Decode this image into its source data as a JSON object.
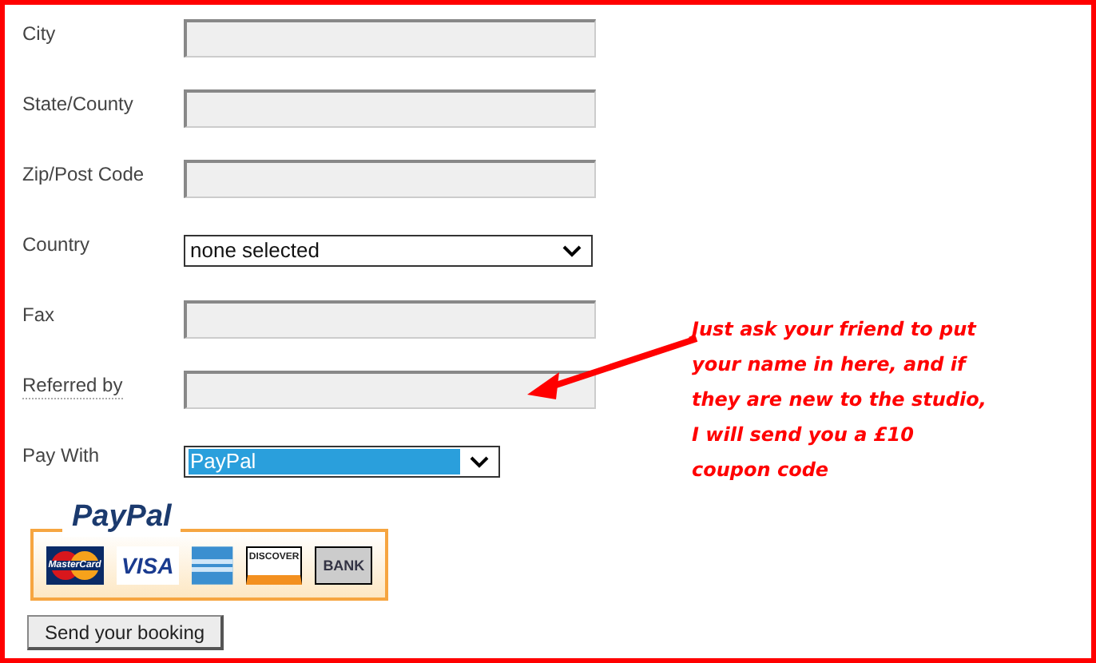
{
  "fields": [
    {
      "label": "City",
      "kind": "text",
      "dotted": false,
      "focused": false
    },
    {
      "label": "State/County",
      "kind": "text",
      "dotted": false,
      "focused": false
    },
    {
      "label": "Zip/Post Code",
      "kind": "text",
      "dotted": false,
      "focused": false
    },
    {
      "label": "Country",
      "kind": "select",
      "value": "none selected",
      "dotted": false,
      "focused": false
    },
    {
      "label": "Fax",
      "kind": "text",
      "dotted": false,
      "focused": false
    },
    {
      "label": "Referred by",
      "kind": "text",
      "dotted": true,
      "focused": false
    },
    {
      "label": "Pay With",
      "kind": "select",
      "value": "PayPal",
      "dotted": false,
      "focused": true
    }
  ],
  "payment_logos": {
    "brand": "PayPal",
    "cards": [
      {
        "kind": "mastercard",
        "label": "MasterCard"
      },
      {
        "kind": "visa",
        "label": "VISA"
      },
      {
        "kind": "amex"
      },
      {
        "kind": "discover",
        "label": "DISCOVER"
      },
      {
        "kind": "bank",
        "label": "BANK"
      }
    ]
  },
  "submit_button": "Send your booking",
  "annotation": {
    "lines": [
      "Just ask your friend to put",
      "your name in here, and if",
      "they are new to the studio,",
      "I will send you a £10",
      "coupon code"
    ]
  }
}
